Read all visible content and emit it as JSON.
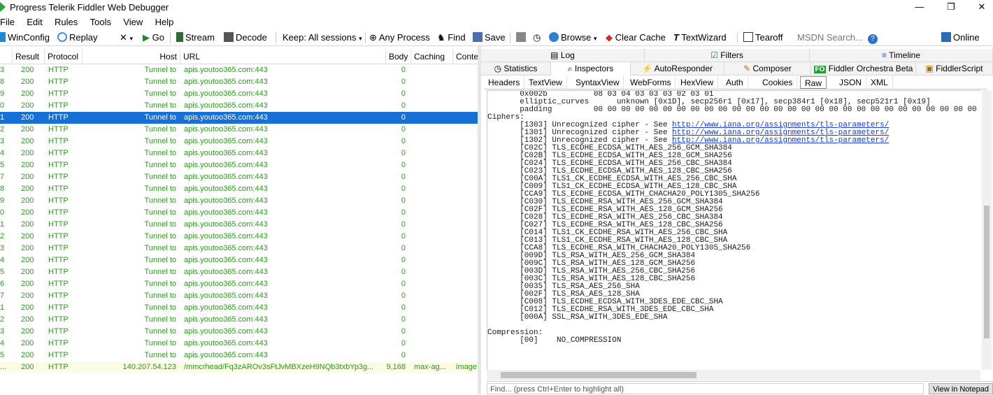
{
  "window": {
    "title": "Progress Telerik Fiddler Web Debugger",
    "minimize": "—",
    "restore": "❐",
    "close": "✕"
  },
  "menu": [
    "File",
    "Edit",
    "Rules",
    "Tools",
    "View",
    "Help"
  ],
  "toolbar": {
    "winconfig": "WinConfig",
    "replay": "Replay",
    "remove": "✕",
    "go": "Go",
    "stream": "Stream",
    "decode": "Decode",
    "keep": "Keep: All sessions",
    "any_process": "Any Process",
    "find": "Find",
    "save": "Save",
    "browse": "Browse",
    "clear_cache": "Clear Cache",
    "textwizard": "TextWizard",
    "tearoff": "Tearoff",
    "msdn_search": "MSDN Search...",
    "online": "Online"
  },
  "grid": {
    "columns": [
      "Result",
      "Protocol",
      "Host",
      "URL",
      "Body",
      "Caching",
      "Conte"
    ],
    "rows": [
      {
        "id": "3",
        "result": "200",
        "protocol": "HTTP",
        "host": "Tunnel to",
        "url": "apis.youtoo365.com:443",
        "body": "0",
        "caching": "",
        "content": ""
      },
      {
        "id": "8",
        "result": "200",
        "protocol": "HTTP",
        "host": "Tunnel to",
        "url": "apis.youtoo365.com:443",
        "body": "0",
        "caching": "",
        "content": ""
      },
      {
        "id": "9",
        "result": "200",
        "protocol": "HTTP",
        "host": "Tunnel to",
        "url": "apis.youtoo365.com:443",
        "body": "0",
        "caching": "",
        "content": ""
      },
      {
        "id": "0",
        "result": "200",
        "protocol": "HTTP",
        "host": "Tunnel to",
        "url": "apis.youtoo365.com:443",
        "body": "0",
        "caching": "",
        "content": ""
      },
      {
        "id": "1",
        "result": "200",
        "protocol": "HTTP",
        "host": "Tunnel to",
        "url": "apis.youtoo365.com:443",
        "body": "0",
        "caching": "",
        "content": "",
        "selected": true
      },
      {
        "id": "2",
        "result": "200",
        "protocol": "HTTP",
        "host": "Tunnel to",
        "url": "apis.youtoo365.com:443",
        "body": "0",
        "caching": "",
        "content": ""
      },
      {
        "id": "3",
        "result": "200",
        "protocol": "HTTP",
        "host": "Tunnel to",
        "url": "apis.youtoo365.com:443",
        "body": "0",
        "caching": "",
        "content": ""
      },
      {
        "id": "4",
        "result": "200",
        "protocol": "HTTP",
        "host": "Tunnel to",
        "url": "apis.youtoo365.com:443",
        "body": "0",
        "caching": "",
        "content": ""
      },
      {
        "id": "5",
        "result": "200",
        "protocol": "HTTP",
        "host": "Tunnel to",
        "url": "apis.youtoo365.com:443",
        "body": "0",
        "caching": "",
        "content": ""
      },
      {
        "id": "7",
        "result": "200",
        "protocol": "HTTP",
        "host": "Tunnel to",
        "url": "apis.youtoo365.com:443",
        "body": "0",
        "caching": "",
        "content": ""
      },
      {
        "id": "8",
        "result": "200",
        "protocol": "HTTP",
        "host": "Tunnel to",
        "url": "apis.youtoo365.com:443",
        "body": "0",
        "caching": "",
        "content": ""
      },
      {
        "id": "9",
        "result": "200",
        "protocol": "HTTP",
        "host": "Tunnel to",
        "url": "apis.youtoo365.com:443",
        "body": "0",
        "caching": "",
        "content": ""
      },
      {
        "id": "0",
        "result": "200",
        "protocol": "HTTP",
        "host": "Tunnel to",
        "url": "apis.youtoo365.com:443",
        "body": "0",
        "caching": "",
        "content": ""
      },
      {
        "id": "1",
        "result": "200",
        "protocol": "HTTP",
        "host": "Tunnel to",
        "url": "apis.youtoo365.com:443",
        "body": "0",
        "caching": "",
        "content": ""
      },
      {
        "id": "2",
        "result": "200",
        "protocol": "HTTP",
        "host": "Tunnel to",
        "url": "apis.youtoo365.com:443",
        "body": "0",
        "caching": "",
        "content": ""
      },
      {
        "id": "3",
        "result": "200",
        "protocol": "HTTP",
        "host": "Tunnel to",
        "url": "apis.youtoo365.com:443",
        "body": "0",
        "caching": "",
        "content": ""
      },
      {
        "id": "4",
        "result": "200",
        "protocol": "HTTP",
        "host": "Tunnel to",
        "url": "apis.youtoo365.com:443",
        "body": "0",
        "caching": "",
        "content": ""
      },
      {
        "id": "5",
        "result": "200",
        "protocol": "HTTP",
        "host": "Tunnel to",
        "url": "apis.youtoo365.com:443",
        "body": "0",
        "caching": "",
        "content": ""
      },
      {
        "id": "6",
        "result": "200",
        "protocol": "HTTP",
        "host": "Tunnel to",
        "url": "apis.youtoo365.com:443",
        "body": "0",
        "caching": "",
        "content": ""
      },
      {
        "id": "7",
        "result": "200",
        "protocol": "HTTP",
        "host": "Tunnel to",
        "url": "apis.youtoo365.com:443",
        "body": "0",
        "caching": "",
        "content": ""
      },
      {
        "id": "1",
        "result": "200",
        "protocol": "HTTP",
        "host": "Tunnel to",
        "url": "apis.youtoo365.com:443",
        "body": "0",
        "caching": "",
        "content": ""
      },
      {
        "id": "2",
        "result": "200",
        "protocol": "HTTP",
        "host": "Tunnel to",
        "url": "apis.youtoo365.com:443",
        "body": "0",
        "caching": "",
        "content": ""
      },
      {
        "id": "3",
        "result": "200",
        "protocol": "HTTP",
        "host": "Tunnel to",
        "url": "apis.youtoo365.com:443",
        "body": "0",
        "caching": "",
        "content": ""
      },
      {
        "id": "4",
        "result": "200",
        "protocol": "HTTP",
        "host": "Tunnel to",
        "url": "apis.youtoo365.com:443",
        "body": "0",
        "caching": "",
        "content": ""
      },
      {
        "id": "5",
        "result": "200",
        "protocol": "HTTP",
        "host": "Tunnel to",
        "url": "apis.youtoo365.com:443",
        "body": "0",
        "caching": "",
        "content": ""
      },
      {
        "id": "...",
        "result": "200",
        "protocol": "HTTP",
        "host": "140.207.54.123",
        "url": "/mmcrhead/Fq3zAROv3sFtJvMBXzeH9NQb3txbYp3g...",
        "body": "9,168",
        "caching": "max-ag...",
        "content": "image",
        "image": true
      }
    ]
  },
  "right_tabs": {
    "row1": [
      "Log",
      "Filters",
      "Timeline"
    ],
    "row2": [
      "Statistics",
      "Inspectors",
      "AutoResponder",
      "Composer",
      "Fiddler Orchestra Beta",
      "FiddlerScript"
    ],
    "fo_badge": "FO",
    "inspector_subtabs": [
      "Headers",
      "TextView",
      "SyntaxView",
      "WebForms",
      "HexView",
      "Auth",
      "Cookies",
      "Raw",
      "JSON",
      "XML"
    ]
  },
  "raw_text": {
    "l1": "       0x002b          08 03 04 03 03 03 02 03 01",
    "l2": "       elliptic_curves      unknown [0x1D], secp256r1 [0x17], secp384r1 [0x18], secp521r1 [0x19]",
    "l3": "       padding         00 00 00 00 00 00 00 00 00 00 00 00 00 00 00 00 00 00 00 00 00 00 00 00 00 00 00 00 00 00 00",
    "l4": "Ciphers:",
    "c1_pre": "       [1303] Unrecognized cipher - See ",
    "c2_pre": "       [1301] Unrecognized cipher - See ",
    "c3_pre": "       [1302] Unrecognized cipher - See ",
    "link": "http://www.iana.org/assignments/tls-parameters/",
    "ciphers": [
      "       [C02C] TLS_ECDHE_ECDSA_WITH_AES_256_GCM_SHA384",
      "       [C02B] TLS_ECDHE_ECDSA_WITH_AES_128_GCM_SHA256",
      "       [C024] TLS_ECDHE_ECDSA_WITH_AES_256_CBC_SHA384",
      "       [C023] TLS_ECDHE_ECDSA_WITH_AES_128_CBC_SHA256",
      "       [C00A] TLS1_CK_ECDHE_ECDSA_WITH_AES_256_CBC_SHA",
      "       [C009] TLS1_CK_ECDHE_ECDSA_WITH_AES_128_CBC_SHA",
      "       [CCA9] TLS_ECDHE_ECDSA_WITH_CHACHA20_POLY1305_SHA256",
      "       [C030] TLS_ECDHE_RSA_WITH_AES_256_GCM_SHA384",
      "       [C02F] TLS_ECDHE_RSA_WITH_AES_128_GCM_SHA256",
      "       [C028] TLS_ECDHE_RSA_WITH_AES_256_CBC_SHA384",
      "       [C027] TLS_ECDHE_RSA_WITH_AES_128_CBC_SHA256",
      "       [C014] TLS1_CK_ECDHE_RSA_WITH_AES_256_CBC_SHA",
      "       [C013] TLS1_CK_ECDHE_RSA_WITH_AES_128_CBC_SHA",
      "       [CCA8] TLS_ECDHE_RSA_WITH_CHACHA20_POLY1305_SHA256",
      "       [009D] TLS_RSA_WITH_AES_256_GCM_SHA384",
      "       [009C] TLS_RSA_WITH_AES_128_GCM_SHA256",
      "       [003D] TLS_RSA_WITH_AES_256_CBC_SHA256",
      "       [003C] TLS_RSA_WITH_AES_128_CBC_SHA256",
      "       [0035] TLS_RSA_AES_256_SHA",
      "       [002F] TLS_RSA_AES_128_SHA",
      "       [C008] TLS_ECDHE_ECDSA_WITH_3DES_EDE_CBC_SHA",
      "       [C012] TLS_ECDHE_RSA_WITH_3DES_EDE_CBC_SHA",
      "       [000A] SSL_RSA_WITH_3DES_EDE_SHA"
    ],
    "comp_title": "Compression:",
    "comp_value": "       [00]    NO_COMPRESSION"
  },
  "find": {
    "placeholder": "Find... (press Ctrl+Enter to highlight all)",
    "notepad": "View in Notepad"
  }
}
